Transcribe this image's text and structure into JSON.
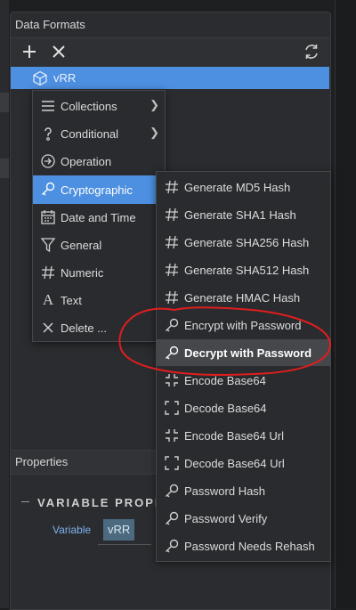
{
  "panel": {
    "title": "Data Formats"
  },
  "toolbar": {
    "add_icon": "plus-icon",
    "remove_icon": "close-icon",
    "refresh_icon": "refresh-icon"
  },
  "tree": {
    "item_label": "vRR",
    "item_icon": "cube-icon"
  },
  "menu": {
    "items": [
      {
        "label": "Collections",
        "icon": "list-icon",
        "submenu": true
      },
      {
        "label": "Conditional",
        "icon": "question-icon",
        "submenu": true
      },
      {
        "label": "Operation",
        "icon": "arrow-circle-icon",
        "submenu": false
      },
      {
        "label": "Cryptographic",
        "icon": "key-icon",
        "submenu": true,
        "active": true
      },
      {
        "label": "Date and Time",
        "icon": "calendar-icon",
        "submenu": true
      },
      {
        "label": "General",
        "icon": "filter-icon",
        "submenu": true
      },
      {
        "label": "Numeric",
        "icon": "hash-icon",
        "submenu": true
      },
      {
        "label": "Text",
        "icon": "text-icon",
        "submenu": true
      },
      {
        "label": "Delete ...",
        "icon": "close-icon",
        "submenu": false
      }
    ]
  },
  "submenu": {
    "items": [
      {
        "label": "Generate MD5 Hash",
        "icon": "hash-icon"
      },
      {
        "label": "Generate SHA1 Hash",
        "icon": "hash-icon"
      },
      {
        "label": "Generate SHA256 Hash",
        "icon": "hash-icon"
      },
      {
        "label": "Generate SHA512 Hash",
        "icon": "hash-icon"
      },
      {
        "label": "Generate HMAC Hash",
        "icon": "hash-icon"
      },
      {
        "label": "Encrypt with Password",
        "icon": "key-icon"
      },
      {
        "label": "Decrypt with Password",
        "icon": "key-icon",
        "hovered": true
      },
      {
        "label": "Encode Base64",
        "icon": "compress-icon"
      },
      {
        "label": "Decode Base64",
        "icon": "expand-icon"
      },
      {
        "label": "Encode Base64 Url",
        "icon": "compress-icon"
      },
      {
        "label": "Decode Base64 Url",
        "icon": "expand-icon"
      },
      {
        "label": "Password Hash",
        "icon": "key-icon"
      },
      {
        "label": "Password Verify",
        "icon": "key-icon"
      },
      {
        "label": "Password Needs Rehash",
        "icon": "key-icon"
      }
    ]
  },
  "properties": {
    "title": "Properties",
    "section_heading": "VARIABLE PROPE",
    "variable_label": "Variable",
    "variable_value": "vRR"
  },
  "colors": {
    "accent": "#4d8fe0",
    "annotation": "#e01e1e",
    "chip": "#4b6a80"
  }
}
